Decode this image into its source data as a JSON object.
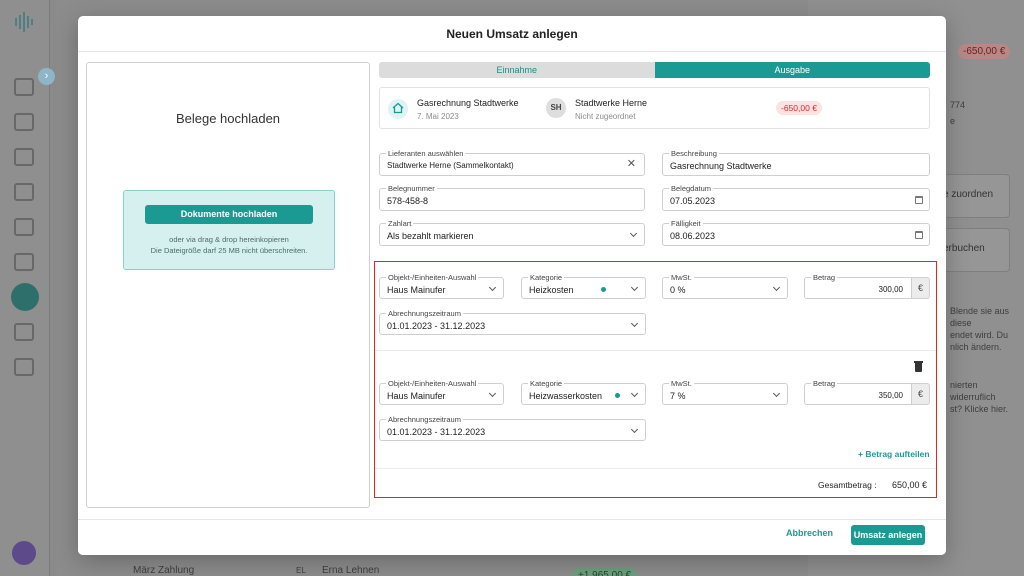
{
  "background": {
    "amount_top_right": "-650,00 €",
    "right_text_1": "774",
    "right_text_2": "e",
    "card_1": "e zuordnen",
    "card_2": "erbuchen",
    "info_lines": [
      "Blende sie aus",
      "diese",
      "endet wird. Du",
      "nlich ändern.",
      "nierten",
      "widerruflich",
      "st? Klicke hier."
    ],
    "row_title": "März Zahlung",
    "row_avatar": "EL",
    "row_name": "Erna Lehnen",
    "row_amount": "+1.965,00 €"
  },
  "modal": {
    "title": "Neuen Umsatz anlegen",
    "upload": {
      "title": "Belege hochladen",
      "button": "Dokumente hochladen",
      "hint_1": "oder via drag & drop hereinkopieren",
      "hint_2": "Die Dateigröße darf 25 MB nicht überschreiten."
    },
    "type_toggle": {
      "income": "Einnahme",
      "expense": "Ausgabe",
      "selected": "Ausgabe"
    },
    "summary": {
      "title": "Gasrechnung Stadtwerke",
      "date": "7. Mai 2023",
      "avatar": "SH",
      "partner": "Stadtwerke Herne",
      "partner_sub": "Nicht zugeordnet",
      "amount": "-650,00 €"
    },
    "form": {
      "supplier": {
        "label": "Lieferanten auswählen",
        "value": "Stadtwerke Herne (Sammelkontakt)"
      },
      "description": {
        "label": "Beschreibung",
        "value": "Gasrechnung Stadtwerke"
      },
      "receipt_number": {
        "label": "Belegnummer",
        "value": "578-458-8"
      },
      "receipt_date": {
        "label": "Belegdatum",
        "value": "07.05.2023"
      },
      "payment_type": {
        "label": "Zahlart",
        "value": "Als bezahlt markieren"
      },
      "due_date": {
        "label": "Fälligkeit",
        "value": "08.06.2023"
      }
    },
    "splits": [
      {
        "object_label": "Objekt-/Einheiten-Auswahl",
        "object": "Haus Mainufer",
        "category_label": "Kategorie",
        "category": "Heizkosten",
        "vat_label": "MwSt.",
        "vat": "0 %",
        "amount_label": "Betrag",
        "amount": "300,00",
        "currency": "€",
        "period_label": "Abrechnungszeitraum",
        "period": "01.01.2023 - 31.12.2023"
      },
      {
        "object_label": "Objekt-/Einheiten-Auswahl",
        "object": "Haus Mainufer",
        "category_label": "Kategorie",
        "category": "Heizwasserkosten",
        "vat_label": "MwSt.",
        "vat": "7 %",
        "amount_label": "Betrag",
        "amount": "350,00",
        "currency": "€",
        "period_label": "Abrechnungszeitraum",
        "period": "01.01.2023 - 31.12.2023"
      }
    ],
    "split_link": "+ Betrag aufteilen",
    "total_label": "Gesamtbetrag :",
    "total_value": "650,00 €",
    "cancel": "Abbrechen",
    "submit": "Umsatz anlegen"
  },
  "colors": {
    "accent": "#1b9a94",
    "danger": "#d22b2b",
    "highlight_border": "#e0262a"
  }
}
